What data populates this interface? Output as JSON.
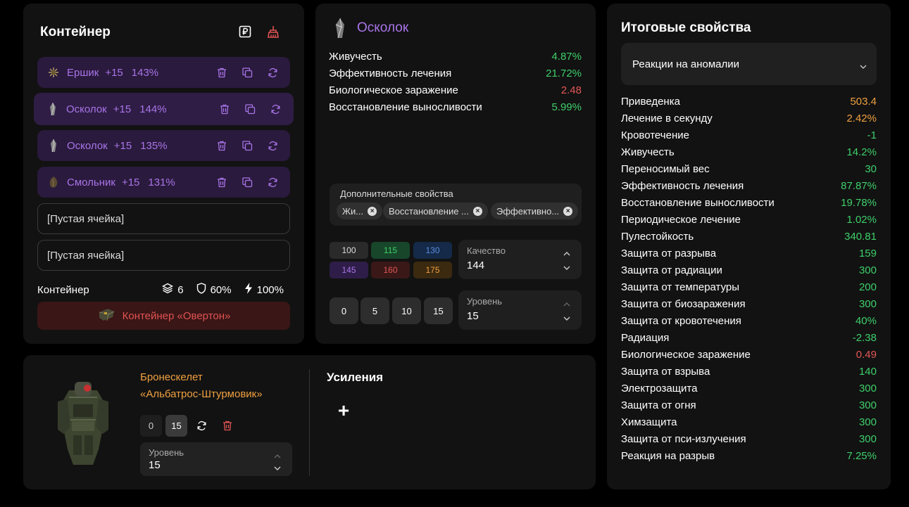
{
  "container": {
    "title": "Контейнер",
    "slots": [
      {
        "name": "Ершик",
        "level": "+15",
        "percent": "143%"
      },
      {
        "name": "Осколок",
        "level": "+15",
        "percent": "144%"
      },
      {
        "name": "Осколок",
        "level": "+15",
        "percent": "135%"
      },
      {
        "name": "Смольник",
        "level": "+15",
        "percent": "131%"
      }
    ],
    "empty_slots": [
      "[Пустая ячейка]",
      "[Пустая ячейка]"
    ],
    "stats_label": "Контейнер",
    "stats": {
      "slots": "6",
      "protection": "60%",
      "efficiency": "100%"
    },
    "container_button": "Контейнер «Овертон»"
  },
  "artifact": {
    "title": "Осколок",
    "properties": [
      {
        "name": "Живучесть",
        "value": "4.87%",
        "color": "green"
      },
      {
        "name": "Эффективность лечения",
        "value": "21.72%",
        "color": "green"
      },
      {
        "name": "Биологическое заражение",
        "value": "2.48",
        "color": "red"
      },
      {
        "name": "Восстановление выносливости",
        "value": "5.99%",
        "color": "green"
      }
    ],
    "extra_label": "Дополнительные свойства",
    "chips": [
      "Жи...",
      "Восстановление ...",
      "Эффективно..."
    ],
    "quality_buttons": [
      {
        "label": "100",
        "bg": "#2a2a2a",
        "fg": "#dddddd"
      },
      {
        "label": "115",
        "bg": "#17462a",
        "fg": "#3ecf6a"
      },
      {
        "label": "130",
        "bg": "#142a48",
        "fg": "#5a8be0"
      },
      {
        "label": "145",
        "bg": "#2e1d48",
        "fg": "#a874e8"
      },
      {
        "label": "160",
        "bg": "#3a1818",
        "fg": "#e35656"
      },
      {
        "label": "175",
        "bg": "#3b2a10",
        "fg": "#f0a040"
      }
    ],
    "quality": {
      "label": "Качество",
      "value": "144"
    },
    "level_buttons": [
      "0",
      "5",
      "10",
      "15"
    ],
    "level": {
      "label": "Уровень",
      "value": "15"
    }
  },
  "totals": {
    "title": "Итоговые свойства",
    "dropdown": "Реакции на аномалии",
    "rows": [
      {
        "name": "Приведенка",
        "value": "503.4",
        "color": "orange"
      },
      {
        "name": "Лечение в секунду",
        "value": "2.42%",
        "color": "orange"
      },
      {
        "name": "Кровотечение",
        "value": "-1",
        "color": "green"
      },
      {
        "name": "Живучесть",
        "value": "14.2%",
        "color": "green"
      },
      {
        "name": "Переносимый вес",
        "value": "30",
        "color": "green"
      },
      {
        "name": "Эффективность лечения",
        "value": "87.87%",
        "color": "green"
      },
      {
        "name": "Восстановление выносливости",
        "value": "19.78%",
        "color": "green"
      },
      {
        "name": "Периодическое лечение",
        "value": "1.02%",
        "color": "green"
      },
      {
        "name": "Пулестойкость",
        "value": "340.81",
        "color": "green"
      },
      {
        "name": "Защита от разрыва",
        "value": "159",
        "color": "green"
      },
      {
        "name": "Защита от радиации",
        "value": "300",
        "color": "green"
      },
      {
        "name": "Защита от температуры",
        "value": "200",
        "color": "green"
      },
      {
        "name": "Защита от биозаражения",
        "value": "300",
        "color": "green"
      },
      {
        "name": "Защита от кровотечения",
        "value": "40%",
        "color": "green"
      },
      {
        "name": "Радиация",
        "value": "-2.38",
        "color": "green"
      },
      {
        "name": "Биологическое заражение",
        "value": "0.49",
        "color": "red"
      },
      {
        "name": "Защита от взрыва",
        "value": "140",
        "color": "green"
      },
      {
        "name": "Электрозащита",
        "value": "300",
        "color": "green"
      },
      {
        "name": "Защита от огня",
        "value": "300",
        "color": "green"
      },
      {
        "name": "Химзащита",
        "value": "300",
        "color": "green"
      },
      {
        "name": "Защита от пси-излучения",
        "value": "300",
        "color": "green"
      },
      {
        "name": "Реакция на разрыв",
        "value": "7.25%",
        "color": "green"
      }
    ]
  },
  "armor": {
    "name_line1": "Бронескелет",
    "name_line2": "«Альбатрос-Штурмовик»",
    "level_buttons": [
      "0",
      "15"
    ],
    "level": {
      "label": "Уровень",
      "value": "15"
    },
    "boosts_title": "Усиления",
    "add_label": "+"
  }
}
